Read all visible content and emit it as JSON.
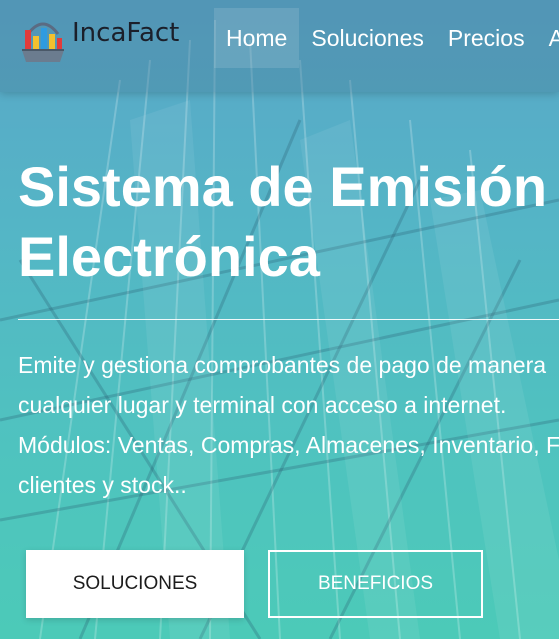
{
  "brand": {
    "name": "IncaFact",
    "logo_icon": "basket-logo-icon"
  },
  "nav": {
    "items": [
      {
        "label": "Home"
      },
      {
        "label": "Soluciones"
      },
      {
        "label": "Precios"
      },
      {
        "label": "A"
      }
    ]
  },
  "hero": {
    "title_line1": "Sistema de Emisión",
    "title_line2": "Electrónica",
    "desc_line1": "Emite y gestiona comprobantes de pago de manera",
    "desc_line2": "cualquier lugar y terminal con acceso a internet.",
    "desc_line3": "Módulos: Ventas, Compras, Almacenes, Inventario, F",
    "desc_line4": "clientes y stock.."
  },
  "buttons": {
    "primary_label": "SOLUCIONES",
    "secondary_label": "BENEFICIOS"
  },
  "colors": {
    "bg_top": "#5aa6c8",
    "bg_bottom": "#4ccab8",
    "text": "#ffffff",
    "brand_text": "#1b1f2a"
  }
}
